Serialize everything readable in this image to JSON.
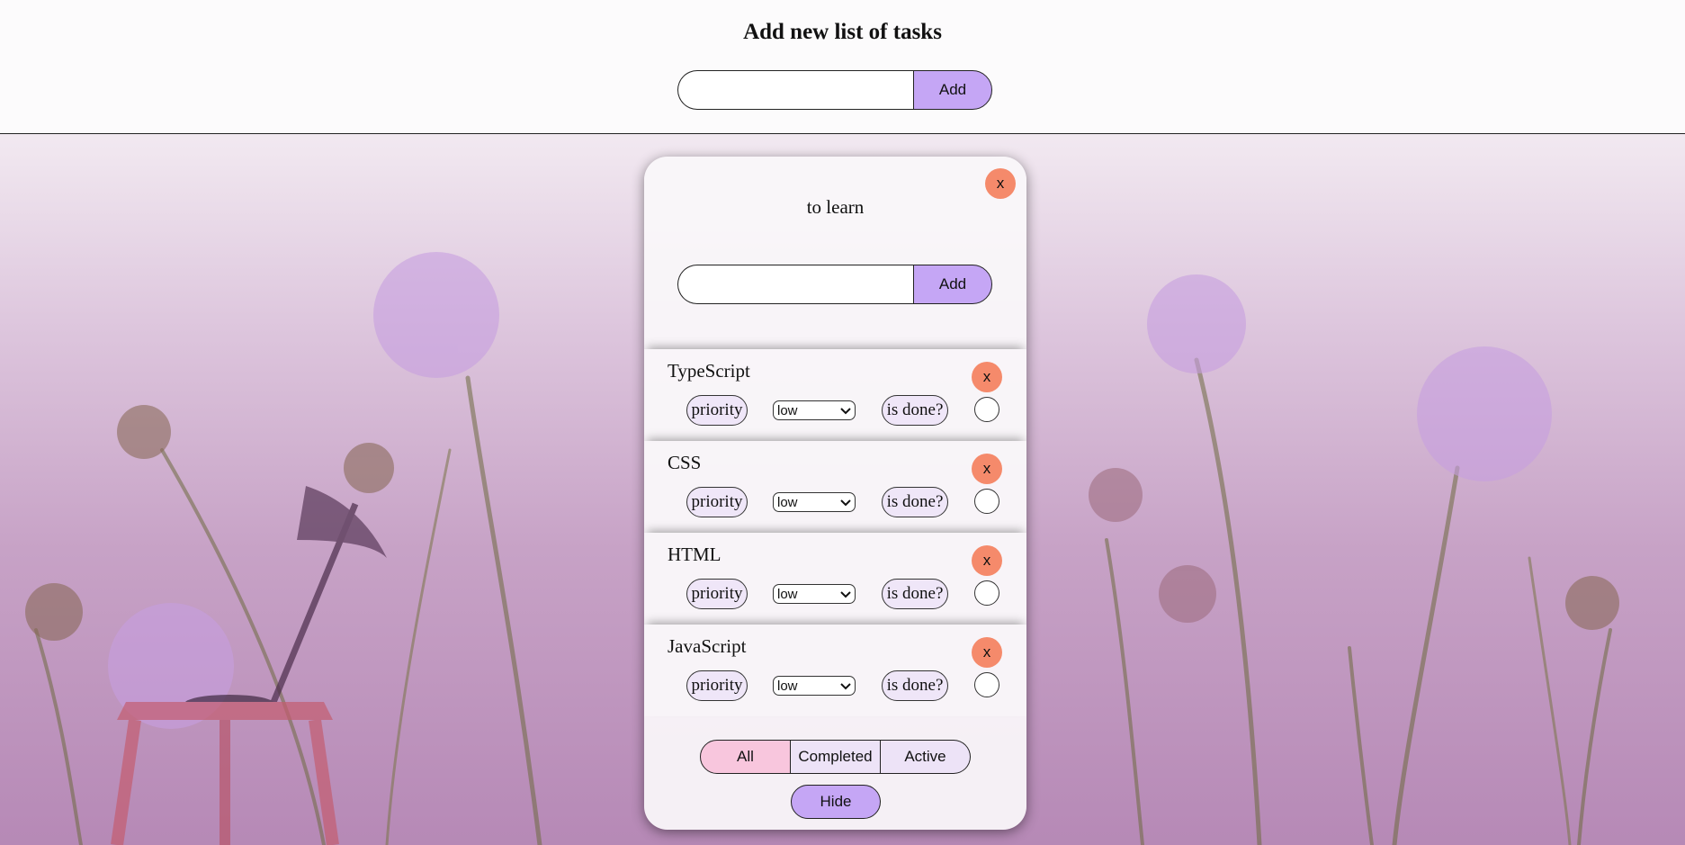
{
  "header": {
    "title": "Add new list of tasks",
    "input_value": "",
    "add_label": "Add"
  },
  "todolist": {
    "title": "to learn",
    "close_label": "x",
    "input_value": "",
    "add_label": "Add",
    "tasks": [
      {
        "name": "TypeScript",
        "close_label": "x",
        "priority_label": "priority",
        "priority_value": "low",
        "done_label": "is done?",
        "done": false
      },
      {
        "name": "CSS",
        "close_label": "x",
        "priority_label": "priority",
        "priority_value": "low",
        "done_label": "is done?",
        "done": false
      },
      {
        "name": "HTML",
        "close_label": "x",
        "priority_label": "priority",
        "priority_value": "low",
        "done_label": "is done?",
        "done": false
      },
      {
        "name": "JavaScript",
        "close_label": "x",
        "priority_label": "priority",
        "priority_value": "low",
        "done_label": "is done?",
        "done": false
      }
    ],
    "filters": {
      "all": "All",
      "completed": "Completed",
      "active": "Active",
      "selected": "All"
    },
    "hide_label": "Hide"
  },
  "colors": {
    "accent": "#c5a6f5",
    "close": "#f58a6b",
    "filter_active": "#f8c6dd"
  }
}
